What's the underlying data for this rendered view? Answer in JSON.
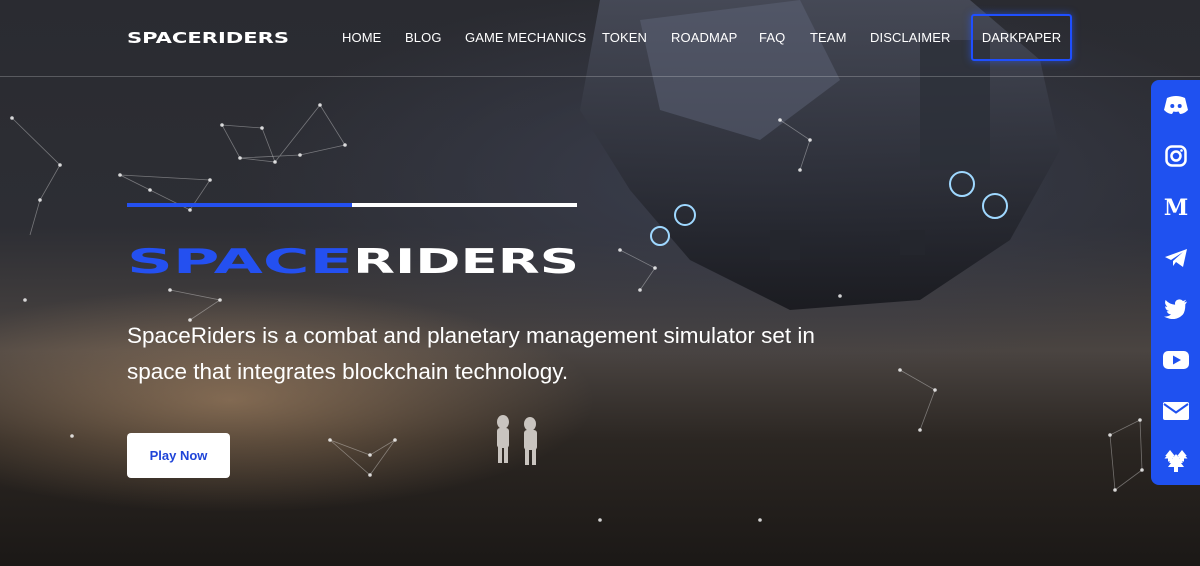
{
  "brand": {
    "name": "SPACERIDERS",
    "name_left": "SPACE",
    "name_right": "RIDERS"
  },
  "nav": {
    "items": [
      "HOME",
      "BLOG",
      "GAME MECHANICS",
      "TOKEN",
      "ROADMAP",
      "FAQ",
      "TEAM",
      "DISCLAIMER"
    ],
    "cta": "DARKPAPER"
  },
  "hero": {
    "tagline": "SpaceRiders is a combat and planetary management simulator set in space that integrates blockchain technology.",
    "button": "Play Now"
  },
  "social": [
    "discord-icon",
    "instagram-icon",
    "medium-icon",
    "telegram-icon",
    "twitter-icon",
    "youtube-icon",
    "email-icon",
    "linktree-icon"
  ],
  "colors": {
    "accent": "#1f51f0",
    "bar_blue": "#2450f0",
    "button_text": "#1f44d8"
  }
}
